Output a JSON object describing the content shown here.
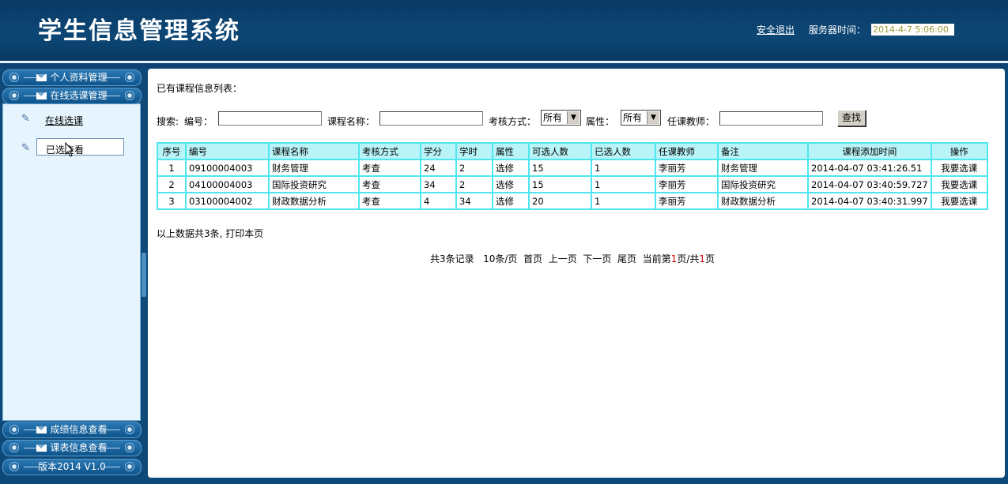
{
  "header": {
    "title": "学生信息管理系统",
    "logout": "安全退出",
    "server_label": "服务器时间：",
    "server_time": "2014-4-7 5:06:00"
  },
  "sidebar": {
    "sections": [
      "个人资料管理",
      "在线选课管理",
      "成绩信息查看",
      "课表信息查看",
      "版本2014 V1.0"
    ],
    "items": [
      "在线选课",
      "已选查看"
    ]
  },
  "main": {
    "list_title": "已有课程信息列表：",
    "search": {
      "prefix": "搜索:",
      "code_label": "编号：",
      "code_value": "",
      "name_label": "课程名称：",
      "name_value": "",
      "exam_label": "考核方式：",
      "exam_value": "所有",
      "attr_label": "属性：",
      "attr_value": "所有",
      "teacher_label": "任课教师：",
      "teacher_value": "",
      "button": "查找"
    },
    "table": {
      "headers": [
        "序号",
        "编号",
        "课程名称",
        "考核方式",
        "学分",
        "学时",
        "属性",
        "可选人数",
        "已选人数",
        "任课教师",
        "备注",
        "课程添加时间",
        "操作"
      ],
      "rows": [
        [
          "1",
          "09100004003",
          "财务管理",
          "考查",
          "24",
          "2",
          "选修",
          "15",
          "1",
          "李丽芳",
          "财务管理",
          "2014-04-07 03:41:26.51",
          "我要选课"
        ],
        [
          "2",
          "04100004003",
          "国际投资研究",
          "考查",
          "34",
          "2",
          "选修",
          "15",
          "1",
          "李丽芳",
          "国际投资研究",
          "2014-04-07 03:40:59.727",
          "我要选课"
        ],
        [
          "3",
          "03100004002",
          "财政数据分析",
          "考查",
          "4",
          "34",
          "选修",
          "20",
          "1",
          "李丽芳",
          "财政数据分析",
          "2014-04-07 03:40:31.997",
          "我要选课"
        ]
      ]
    },
    "summary": "以上数据共3条, 打印本页",
    "pager": {
      "total": "共3条记录",
      "per_page": "10条/页",
      "first": "首页",
      "prev": "上一页",
      "next": "下一页",
      "last": "尾页",
      "current_prefix": "当前第",
      "current": "1",
      "of_prefix": "页/共",
      "total_pages": "1",
      "suffix": "页"
    }
  }
}
